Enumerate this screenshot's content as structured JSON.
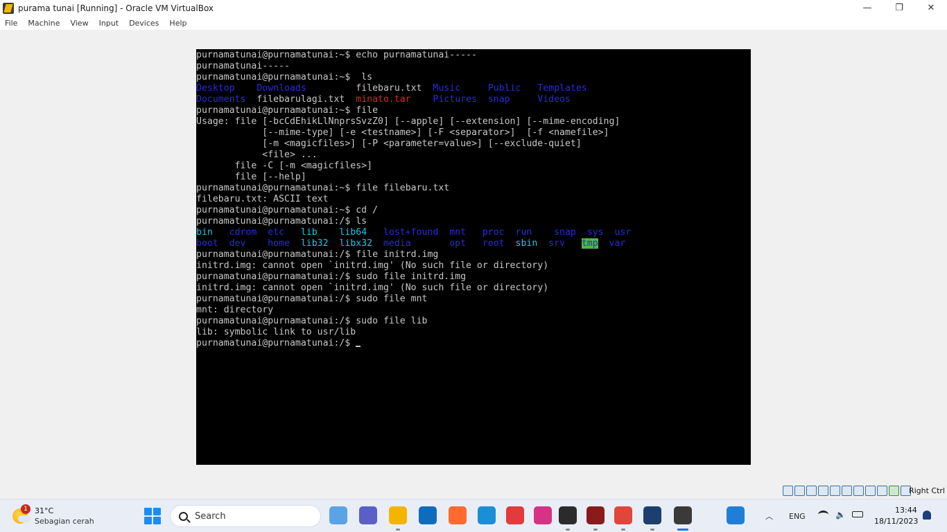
{
  "window": {
    "title": "purama tunai [Running] - Oracle VM VirtualBox",
    "minimize": "—",
    "maximize": "❐",
    "close": "✕"
  },
  "menu": [
    "File",
    "Machine",
    "View",
    "Input",
    "Devices",
    "Help"
  ],
  "terminal": {
    "lines": [
      [
        [
          "purnamatunai@purnamatunai:~$ echo purnamatunai-----",
          "default"
        ]
      ],
      [
        [
          "purnamatunai-----",
          "default"
        ]
      ],
      [
        [
          "purnamatunai@purnamatunai:~$  ls",
          "default"
        ]
      ],
      [
        [
          "Desktop    Downloads         ",
          "blue"
        ],
        [
          "filebaru.txt  ",
          "default"
        ],
        [
          "Music     Public   Templates",
          "blue"
        ]
      ],
      [
        [
          "Documents  ",
          "blue"
        ],
        [
          "filebarulagi.txt  ",
          "default"
        ],
        [
          "minato.tar",
          "red"
        ],
        [
          "    Pictures  snap     Videos",
          "blue"
        ]
      ],
      [
        [
          "purnamatunai@purnamatunai:~$ file",
          "default"
        ]
      ],
      [
        [
          "Usage: file [-bcCdEhikLlNnprsSvzZ0] [--apple] [--extension] [--mime-encoding]",
          "default"
        ]
      ],
      [
        [
          "            [--mime-type] [-e <testname>] [-F <separator>]  [-f <namefile>]",
          "default"
        ]
      ],
      [
        [
          "            [-m <magicfiles>] [-P <parameter=value>] [--exclude-quiet]",
          "default"
        ]
      ],
      [
        [
          "            <file> ...",
          "default"
        ]
      ],
      [
        [
          "       file -C [-m <magicfiles>]",
          "default"
        ]
      ],
      [
        [
          "       file [--help]",
          "default"
        ]
      ],
      [
        [
          "purnamatunai@purnamatunai:~$ file filebaru.txt",
          "default"
        ]
      ],
      [
        [
          "filebaru.txt: ASCII text",
          "default"
        ]
      ],
      [
        [
          "purnamatunai@purnamatunai:~$ cd /",
          "default"
        ]
      ],
      [
        [
          "purnamatunai@purnamatunai:/$ ls",
          "default"
        ]
      ],
      [
        [
          "bin   ",
          "cyan"
        ],
        [
          "cdrom  etc   ",
          "blue"
        ],
        [
          "lib    lib64   ",
          "cyan"
        ],
        [
          "lost+found  mnt   proc  run    snap  sys  usr",
          "blue"
        ]
      ],
      [
        [
          "boot  dev    home  ",
          "blue"
        ],
        [
          "lib32  libx32  ",
          "cyan"
        ],
        [
          "media       opt   root  ",
          "blue"
        ],
        [
          "sbin",
          "cyan"
        ],
        [
          "  srv   ",
          "blue"
        ],
        [
          "tmp",
          "tmp"
        ],
        [
          "  var",
          "blue"
        ]
      ],
      [
        [
          "purnamatunai@purnamatunai:/$ file initrd.img",
          "default"
        ]
      ],
      [
        [
          "initrd.img: cannot open `initrd.img' (No such file or directory)",
          "default"
        ]
      ],
      [
        [
          "purnamatunai@purnamatunai:/$ sudo file initrd.img",
          "default"
        ]
      ],
      [
        [
          "initrd.img: cannot open `initrd.img' (No such file or directory)",
          "default"
        ]
      ],
      [
        [
          "purnamatunai@purnamatunai:/$ sudo file mnt",
          "default"
        ]
      ],
      [
        [
          "mnt: directory",
          "default"
        ]
      ],
      [
        [
          "purnamatunai@purnamatunai:/$ sudo file lib",
          "default"
        ]
      ],
      [
        [
          "lib: symbolic link to usr/lib",
          "default"
        ]
      ],
      [
        [
          "purnamatunai@purnamatunai:/$ ",
          "default"
        ]
      ]
    ]
  },
  "statusbar": {
    "host_key": "Right Ctrl"
  },
  "taskbar": {
    "weather_temp": "31°C",
    "weather_condition": "Sebagian cerah",
    "weather_badge": "1",
    "search_placeholder": "Search",
    "language": "ENG",
    "time": "13:44",
    "date": "18/11/2023",
    "apps": [
      {
        "name": "copilot-icon",
        "color": "#5aa4e6"
      },
      {
        "name": "teams-icon",
        "color": "#5b5fc7"
      },
      {
        "name": "file-explorer-icon",
        "color": "#f4b400"
      },
      {
        "name": "microsoft-store-icon",
        "color": "#0f6cbd"
      },
      {
        "name": "firefox-icon",
        "color": "#ff6b2c"
      },
      {
        "name": "edge-icon",
        "color": "#1b8fd6"
      },
      {
        "name": "snipping-tool-icon",
        "color": "#e23b3b"
      },
      {
        "name": "wps-office-icon",
        "color": "#d63384"
      },
      {
        "name": "terminal-icon",
        "color": "#2b2b2b"
      },
      {
        "name": "winrar-icon",
        "color": "#8b1a1a"
      },
      {
        "name": "chrome-icon",
        "color": "#e0463a"
      },
      {
        "name": "virtualbox-icon",
        "color": "#1c3f6e"
      },
      {
        "name": "virtualbox-vm-icon",
        "color": "#3a3a3a"
      },
      {
        "name": "paint-icon",
        "color": "#1f7fd6"
      }
    ]
  }
}
